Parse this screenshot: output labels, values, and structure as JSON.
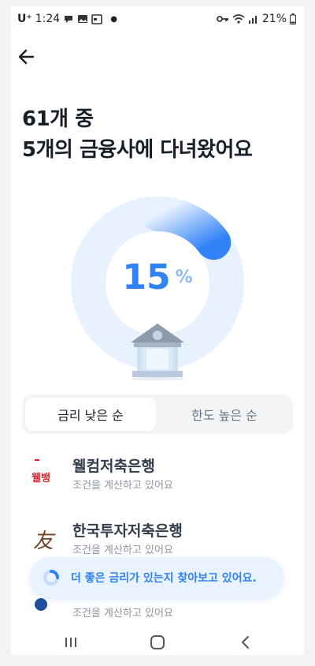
{
  "status_bar": {
    "carrier": "U⁺",
    "time": "1:24",
    "battery": "21%"
  },
  "header": {
    "title_line1": "61개 중",
    "title_line2": "5개의 금융사에 다녀왔어요"
  },
  "progress": {
    "value": "15",
    "unit": "%",
    "fraction": 0.15
  },
  "tabs": [
    {
      "label": "금리 낮은 순",
      "active": true
    },
    {
      "label": "한도 높은 순",
      "active": false
    }
  ],
  "banks": [
    {
      "name": "웰컴저축은행",
      "status": "조건을 계산하고 있어요",
      "logo_text": "웰뱅"
    },
    {
      "name": "한국투자저축은행",
      "status": "조건을 계산하고 있어요",
      "logo_text": "友"
    },
    {
      "name": "",
      "status": "조건을 계산하고 있어요",
      "logo_text": ""
    }
  ],
  "toast": {
    "message": "더 좋은 금리가 있는지 찾아보고 있어요."
  },
  "colors": {
    "accent": "#3182f6",
    "donut_track": "#e8f2fe",
    "welcome_red": "#e0202a"
  }
}
